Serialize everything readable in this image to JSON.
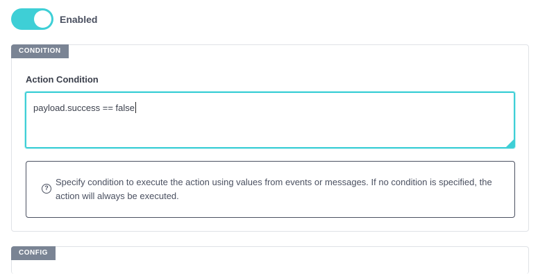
{
  "toggle": {
    "label": "Enabled",
    "state": "on",
    "color": "#3ecfd6"
  },
  "condition_section": {
    "tag": "CONDITION",
    "field_label": "Action Condition",
    "input_value": "payload.success == false",
    "help_icon": "?",
    "help_text": "Specify condition to execute the action using values from events or messages. If no condition is specified, the action will always be executed."
  },
  "config_section": {
    "tag": "CONFIG"
  }
}
